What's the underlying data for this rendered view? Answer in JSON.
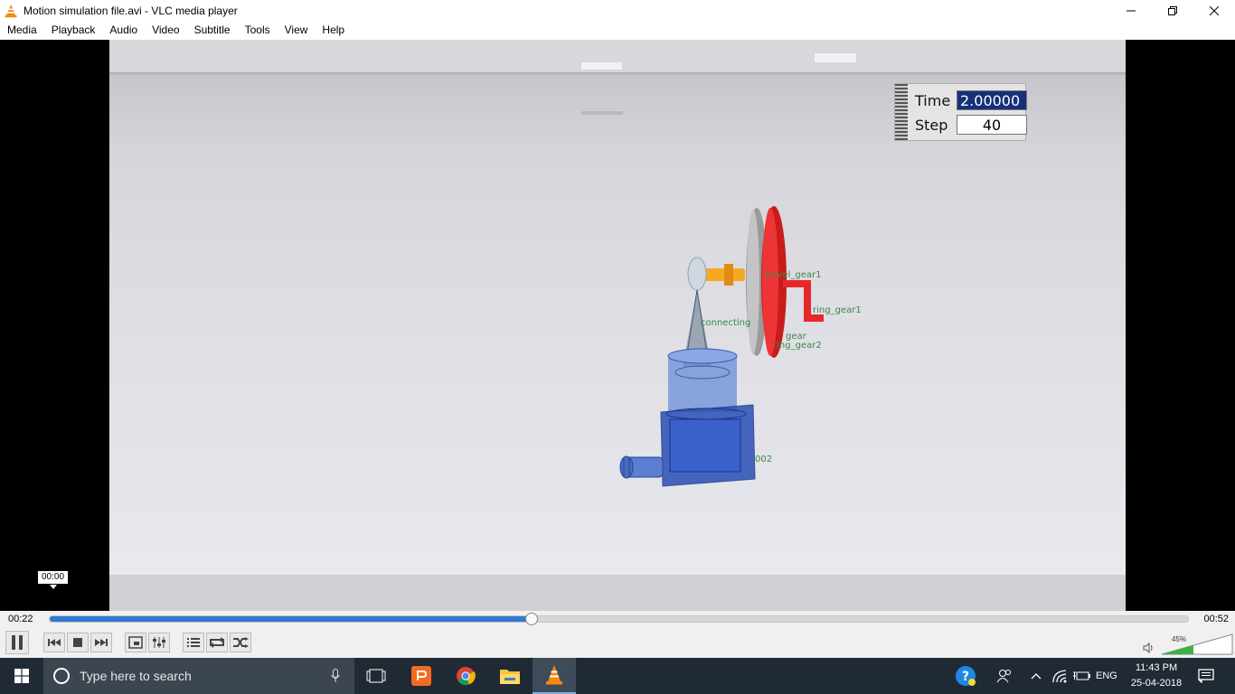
{
  "window": {
    "title": "Motion simulation file.avi - VLC media player",
    "icon": "vlc-cone-icon",
    "controls": [
      "minimize-icon",
      "restore-icon",
      "close-icon"
    ]
  },
  "menu": {
    "items": [
      "Media",
      "Playback",
      "Audio",
      "Video",
      "Subtitle",
      "Tools",
      "View",
      "Help"
    ]
  },
  "video": {
    "hud": {
      "time_label": "Time",
      "time_value": "2.00000",
      "step_label": "Step",
      "step_value": "40"
    },
    "scene_labels": [
      "bevel_gear1",
      "ring_gear1",
      "connecting",
      "gear",
      "ring_gear2",
      "002"
    ],
    "hover_timecode": "00:00"
  },
  "seek": {
    "elapsed": "00:22",
    "total": "00:52",
    "progress": 0.423
  },
  "controls": {
    "buttons": [
      "pause-icon",
      "previous-icon",
      "stop-icon",
      "next-icon",
      "fullscreen-icon",
      "extended-settings-icon",
      "playlist-icon",
      "loop-icon",
      "random-icon"
    ],
    "volume": {
      "percent_label": "45%",
      "level": 0.45
    }
  },
  "taskbar": {
    "search_placeholder": "Type here to search",
    "apps": [
      "task-view-icon",
      "presentation-app-icon",
      "chrome-icon",
      "file-explorer-icon",
      "vlc-icon"
    ],
    "tray": [
      "help-icon",
      "people-icon",
      "chevron-up-icon",
      "wifi-icon",
      "battery-icon"
    ],
    "language": "ENG",
    "time": "11:43 PM",
    "date": "25-04-2018",
    "notifications_icon": "action-center-icon"
  }
}
